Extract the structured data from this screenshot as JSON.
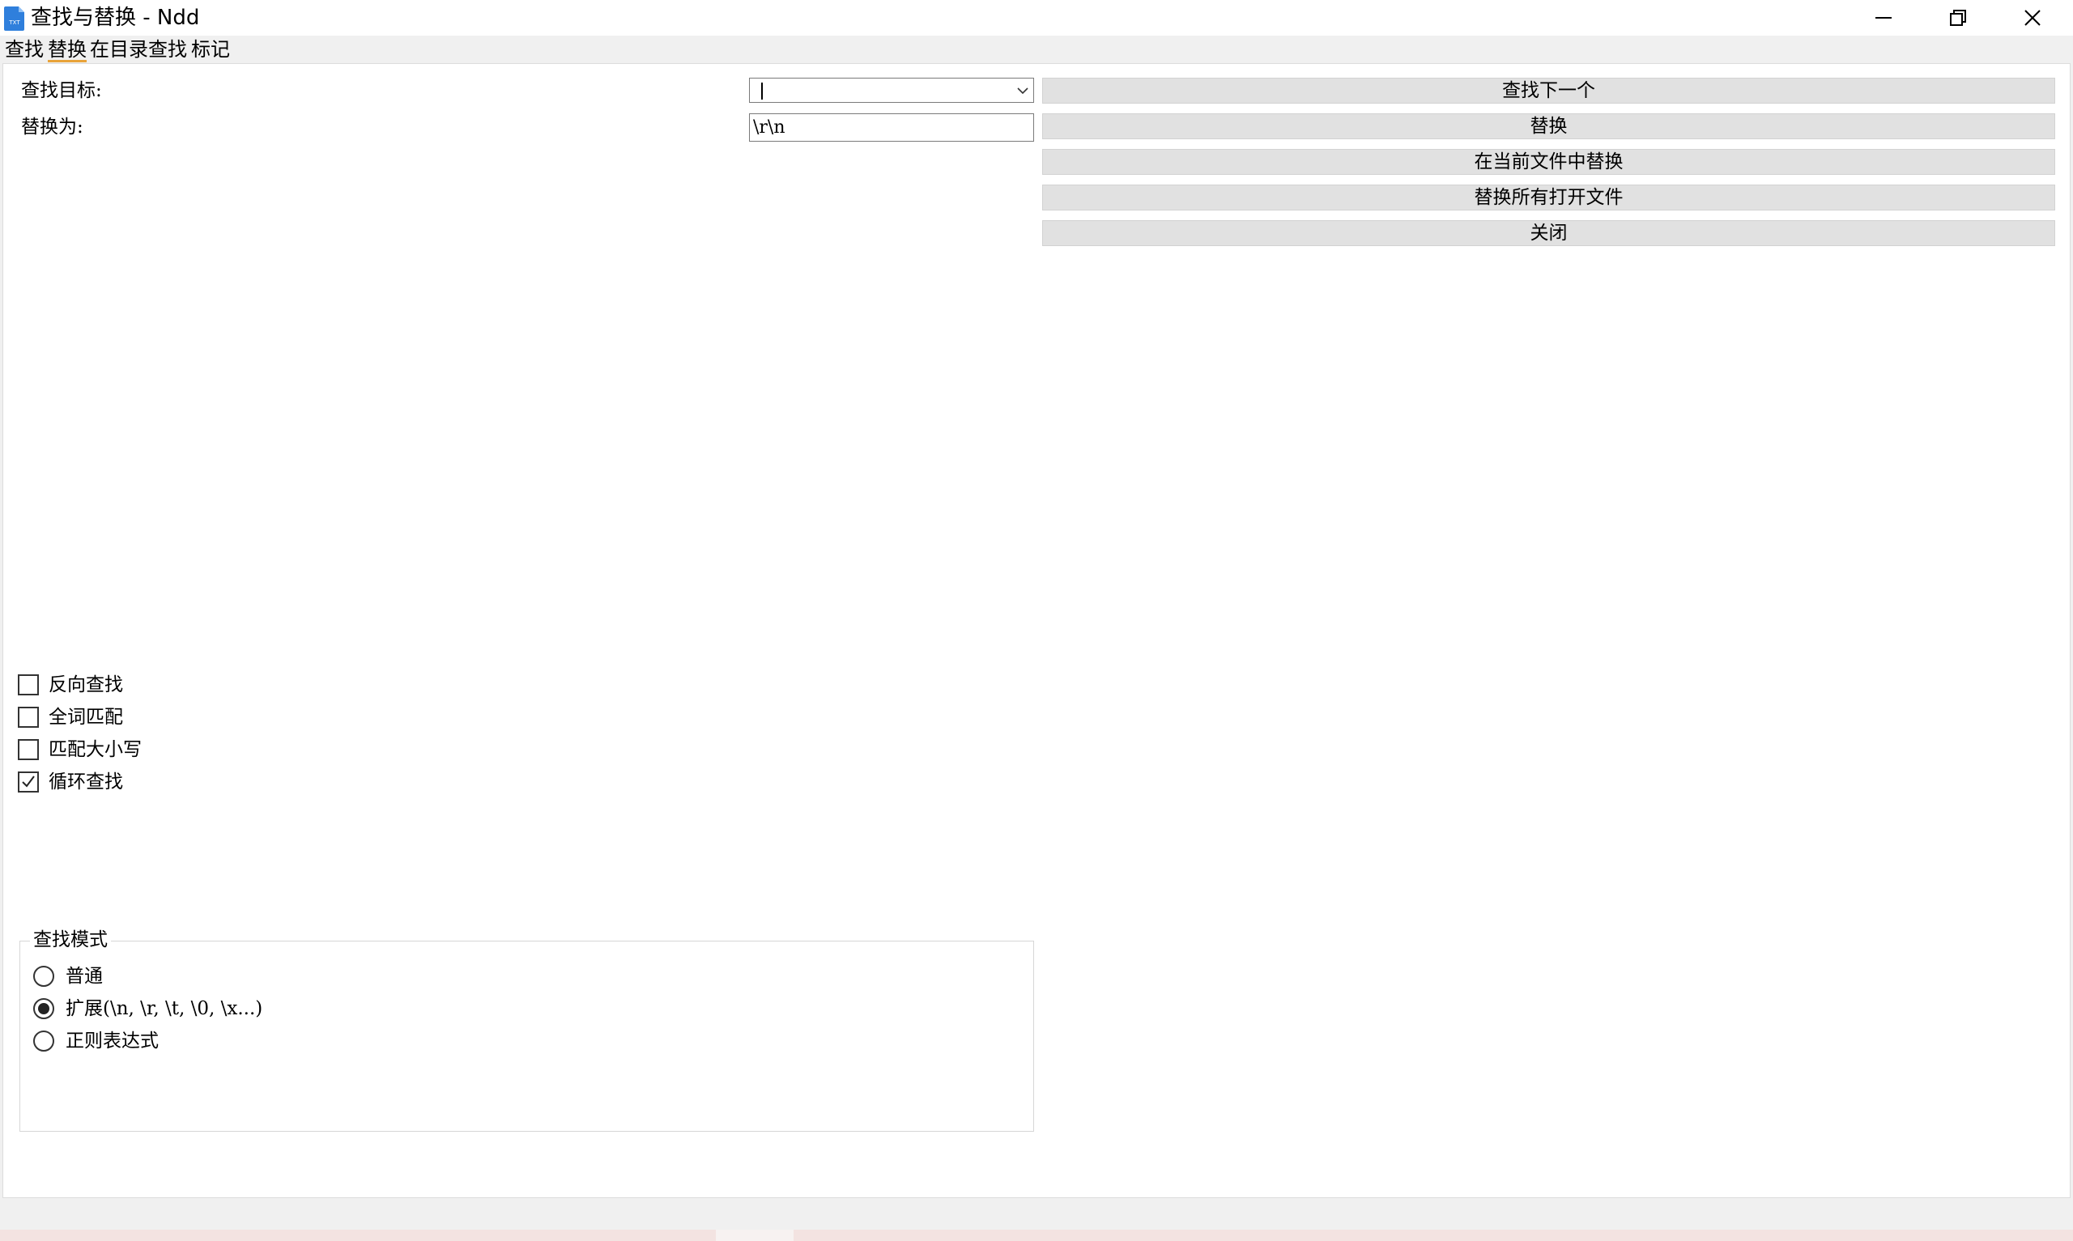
{
  "window": {
    "title": "查找与替换 - Ndd"
  },
  "tabs": [
    {
      "label": "查找"
    },
    {
      "label": "替换"
    },
    {
      "label": "在目录查找"
    },
    {
      "label": "标记"
    }
  ],
  "active_tab": "替换",
  "form": {
    "find_label": "查找目标:",
    "find_value": "",
    "replace_label": "替换为:",
    "replace_value": "\\r\\n"
  },
  "buttons": {
    "find_next": "查找下一个",
    "replace": "替换",
    "replace_in_current": "在当前文件中替换",
    "replace_all_open": "替换所有打开文件",
    "close": "关闭"
  },
  "options": [
    {
      "label": "反向查找",
      "checked": false
    },
    {
      "label": "全词匹配",
      "checked": false
    },
    {
      "label": "匹配大小写",
      "checked": false
    },
    {
      "label": "循环查找",
      "checked": true
    }
  ],
  "search_mode": {
    "title": "查找模式",
    "modes": [
      {
        "label": "普通",
        "selected": false
      },
      {
        "label": "扩展(\\n, \\r, \\t, \\0, \\x...)",
        "selected": true
      },
      {
        "label": "正则表达式",
        "selected": false
      }
    ]
  },
  "colors": {
    "tab_accent": "#e8a33a",
    "button_bg": "#e1e1e1",
    "app_icon": "#2f7fdc"
  }
}
